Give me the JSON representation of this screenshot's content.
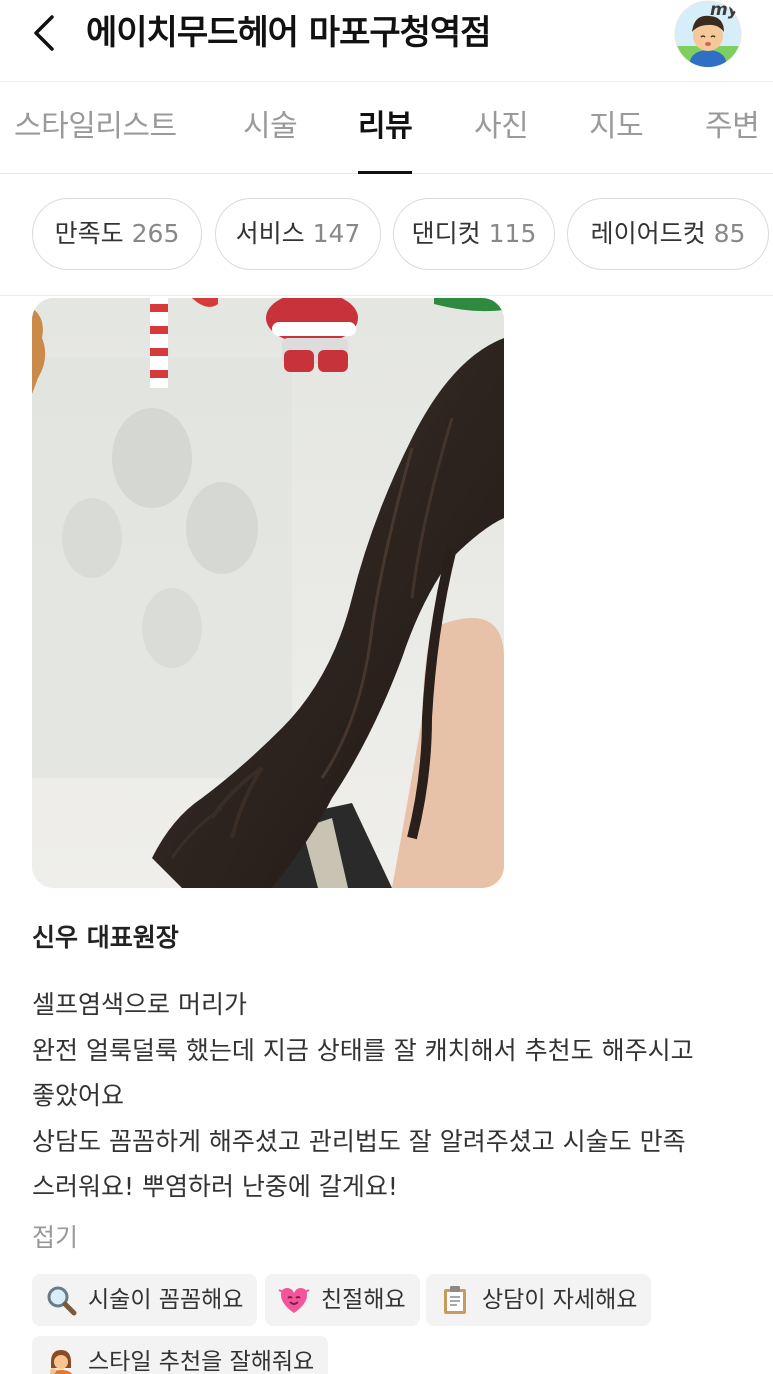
{
  "header": {
    "title": "에이치무드헤어 마포구청역점",
    "avatar_badge": "my"
  },
  "tabs": [
    {
      "label": "스타일리스트",
      "active": false
    },
    {
      "label": "시술",
      "active": false
    },
    {
      "label": "리뷰",
      "active": true
    },
    {
      "label": "사진",
      "active": false
    },
    {
      "label": "지도",
      "active": false
    },
    {
      "label": "주변",
      "active": false
    }
  ],
  "filters": [
    {
      "label": "만족도",
      "count": "265"
    },
    {
      "label": "서비스",
      "count": "147"
    },
    {
      "label": "댄디컷",
      "count": "115"
    },
    {
      "label": "레이어드컷",
      "count": "85"
    }
  ],
  "review": {
    "stylist": "신우 대표원장",
    "lines": [
      "셀프염색으로 머리가",
      "완전 얼룩덜룩 했는데 지금 상태를 잘 캐치해서 추천도 해주시고",
      "좋았어요",
      "상담도 꼼꼼하게 해주셨고 관리법도 잘 알려주셨고 시술도 만족",
      "스러워요! 뿌염하러 난중에 갈게요!"
    ],
    "fold_label": "접기"
  },
  "tags": [
    {
      "icon": "magnifier-icon",
      "label": "시술이 꼼꼼해요"
    },
    {
      "icon": "heart-face-icon",
      "label": "친절해요"
    },
    {
      "icon": "clipboard-icon",
      "label": "상담이 자세해요"
    },
    {
      "icon": "person-gesture-icon",
      "label": "스타일 추천을 잘해줘요"
    }
  ],
  "colors": {
    "accent": "#111111",
    "inactive_tab": "#9a9a9a",
    "tag_bg": "#f3f3f3"
  }
}
